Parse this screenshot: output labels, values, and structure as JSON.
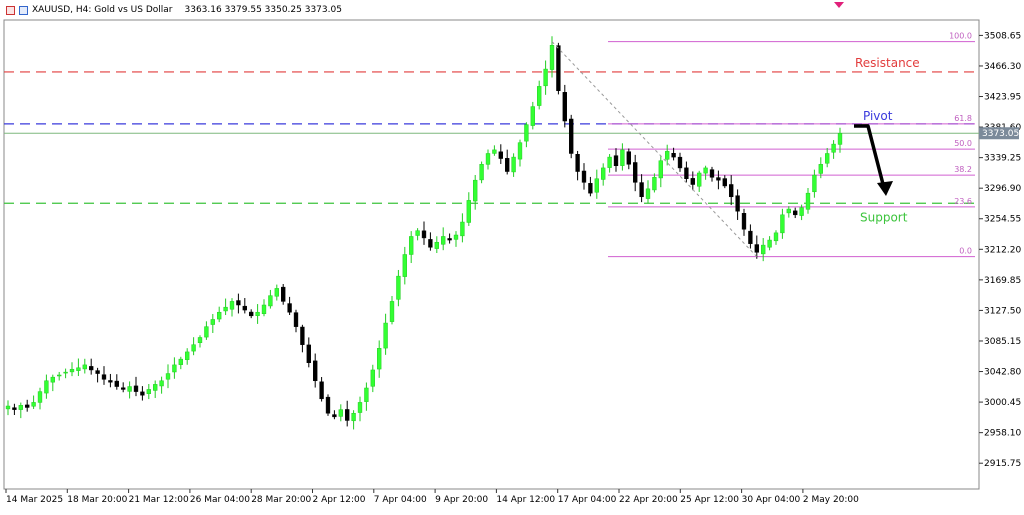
{
  "header": {
    "symbol_text": "XAUUSD, H4:  Gold vs US Dollar",
    "ohlc_text": "3363.16 3379.55 3350.25 3373.05"
  },
  "chart_data": {
    "type": "candlestick",
    "symbol": "XAUUSD",
    "timeframe": "H4",
    "ylim": [
      2880.0,
      3530.0
    ],
    "y_ticks": [
      3508.65,
      3466.3,
      3423.95,
      3381.6,
      3339.25,
      3296.9,
      3254.55,
      3212.2,
      3169.85,
      3127.5,
      3085.15,
      3042.8,
      3000.45,
      2958.1,
      2915.75
    ],
    "x_ticks": [
      "14 Mar 2025",
      "18 Mar 20:00",
      "21 Mar 12:00",
      "26 Mar 04:00",
      "28 Mar 20:00",
      "2 Apr 12:00",
      "7 Apr 04:00",
      "9 Apr 20:00",
      "14 Apr 12:00",
      "17 Apr 04:00",
      "22 Apr 20:00",
      "25 Apr 12:00",
      "30 Apr 04:00",
      "2 May 20:00"
    ],
    "current_price": "3373.05",
    "close_path": [
      2995,
      2990,
      2996,
      2993,
      3000,
      3015,
      3030,
      3035,
      3038,
      3042,
      3046,
      3048,
      3052,
      3045,
      3040,
      3032,
      3028,
      3022,
      3018,
      3022,
      3015,
      3010,
      3018,
      3025,
      3030,
      3040,
      3052,
      3060,
      3070,
      3080,
      3090,
      3105,
      3115,
      3125,
      3132,
      3140,
      3135,
      3128,
      3120,
      3125,
      3135,
      3148,
      3158,
      3140,
      3125,
      3105,
      3080,
      3055,
      3030,
      3005,
      2985,
      2980,
      2990,
      2975,
      2985,
      3000,
      3020,
      3045,
      3075,
      3110,
      3140,
      3175,
      3205,
      3230,
      3238,
      3228,
      3215,
      3222,
      3230,
      3225,
      3232,
      3250,
      3280,
      3308,
      3330,
      3345,
      3350,
      3338,
      3320,
      3340,
      3360,
      3385,
      3410,
      3438,
      3462,
      3495,
      3432,
      3390,
      3345,
      3320,
      3305,
      3290,
      3310,
      3325,
      3340,
      3328,
      3350,
      3330,
      3305,
      3285,
      3296,
      3312,
      3335,
      3348,
      3340,
      3325,
      3310,
      3302,
      3318,
      3325,
      3312,
      3308,
      3300,
      3285,
      3265,
      3240,
      3220,
      3208,
      3218,
      3225,
      3235,
      3260,
      3268,
      3260,
      3270,
      3290,
      3315,
      3330,
      3345,
      3358,
      3373.05
    ],
    "fibonacci": {
      "high": 3500.0,
      "low": 3202.0,
      "levels": [
        {
          "label": "100.0",
          "value": 3500.0
        },
        {
          "label": "61.8",
          "value": 3386.0
        },
        {
          "label": "50.0",
          "value": 3351.0
        },
        {
          "label": "38.2",
          "value": 3315.0
        },
        {
          "label": "23.6",
          "value": 3271.0
        },
        {
          "label": "0.0",
          "value": 3202.0
        }
      ]
    },
    "lines": {
      "resistance": {
        "label": "Resistance",
        "value": 3458.0,
        "color": "#e23c3c"
      },
      "pivot": {
        "label": "Pivot",
        "value": 3386.0,
        "color": "#3a3adc"
      },
      "support": {
        "label": "Support",
        "value": 3276.0,
        "color": "#3cc43c"
      },
      "price_line_color": "#7fb87f"
    },
    "candle_colors": {
      "up": "#33ff33",
      "down": "#000000"
    }
  }
}
